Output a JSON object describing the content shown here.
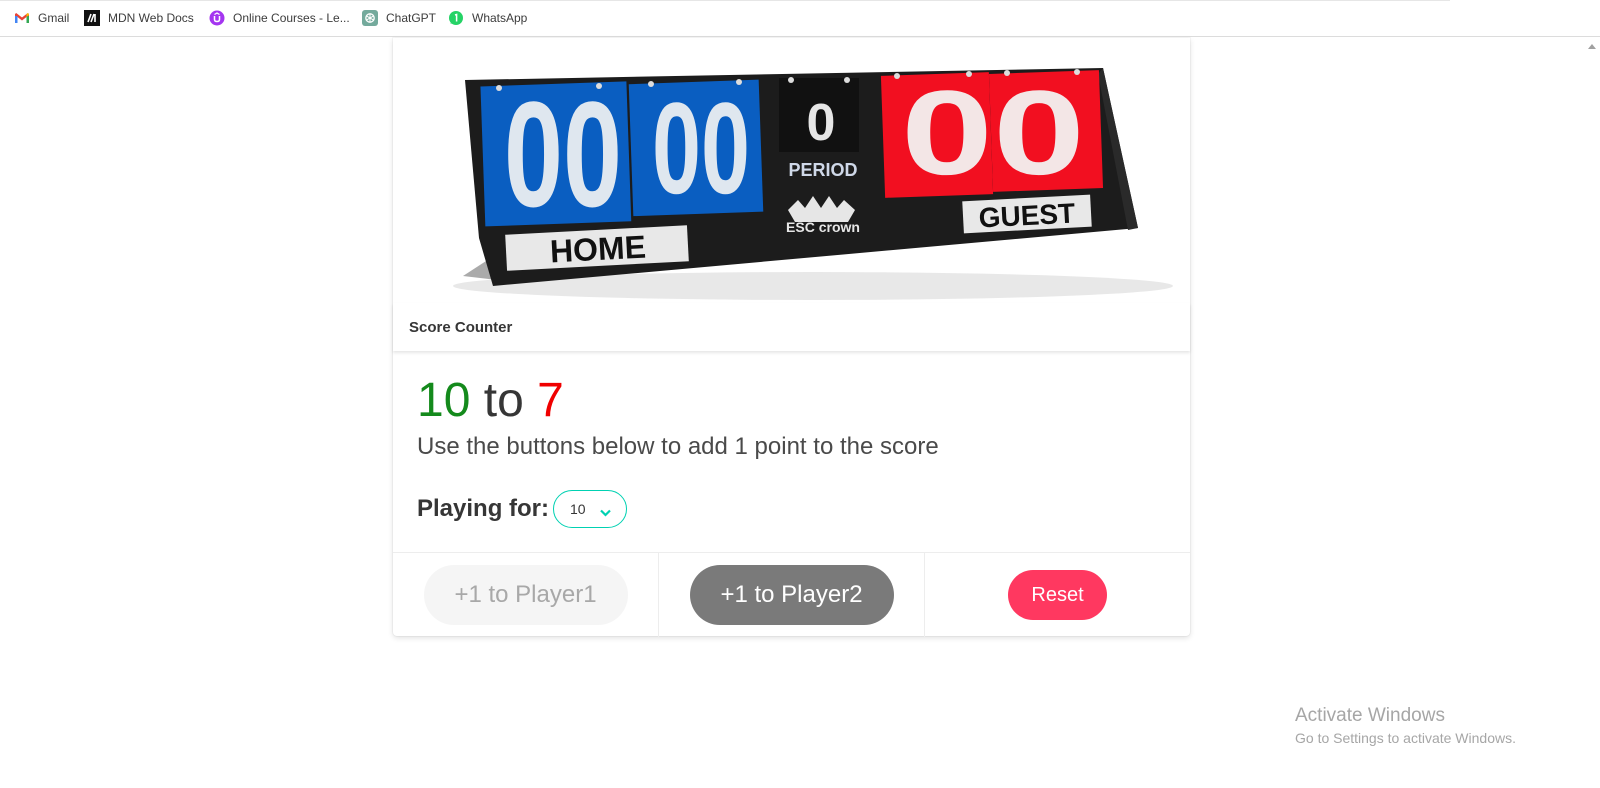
{
  "bookmarks": [
    {
      "label": "Gmail",
      "icon": "gmail-icon"
    },
    {
      "label": "MDN Web Docs",
      "icon": "mdn-icon"
    },
    {
      "label": "Online Courses - Le...",
      "icon": "udemy-icon"
    },
    {
      "label": "ChatGPT",
      "icon": "chatgpt-icon"
    },
    {
      "label": "WhatsApp",
      "icon": "whatsapp-icon"
    }
  ],
  "scoreboard_image": {
    "home_score": "00",
    "period": "0",
    "period_label": "PERIOD",
    "guest_score": "00",
    "home_label": "HOME",
    "guest_label": "GUEST",
    "brand": "ESC crown",
    "colors": {
      "home": "#0a5ec1",
      "guest": "#f20f20",
      "body": "#1a1a1a"
    }
  },
  "card": {
    "title": "Score Counter",
    "player1_score": "10",
    "separator": "to",
    "player2_score": "7",
    "hint": "Use the buttons below to add 1 point to the score",
    "playing_for_label": "Playing for:",
    "playing_for_value": "10"
  },
  "buttons": {
    "player1": "+1 to Player1",
    "player2": "+1 to Player2",
    "reset": "Reset"
  },
  "windows_watermark": {
    "title": "Activate Windows",
    "subtitle": "Go to Settings to activate Windows."
  },
  "colors": {
    "player1": "#148a1c",
    "player2": "#f00000",
    "reset": "#ff3860",
    "select_border": "#00d1b2"
  }
}
